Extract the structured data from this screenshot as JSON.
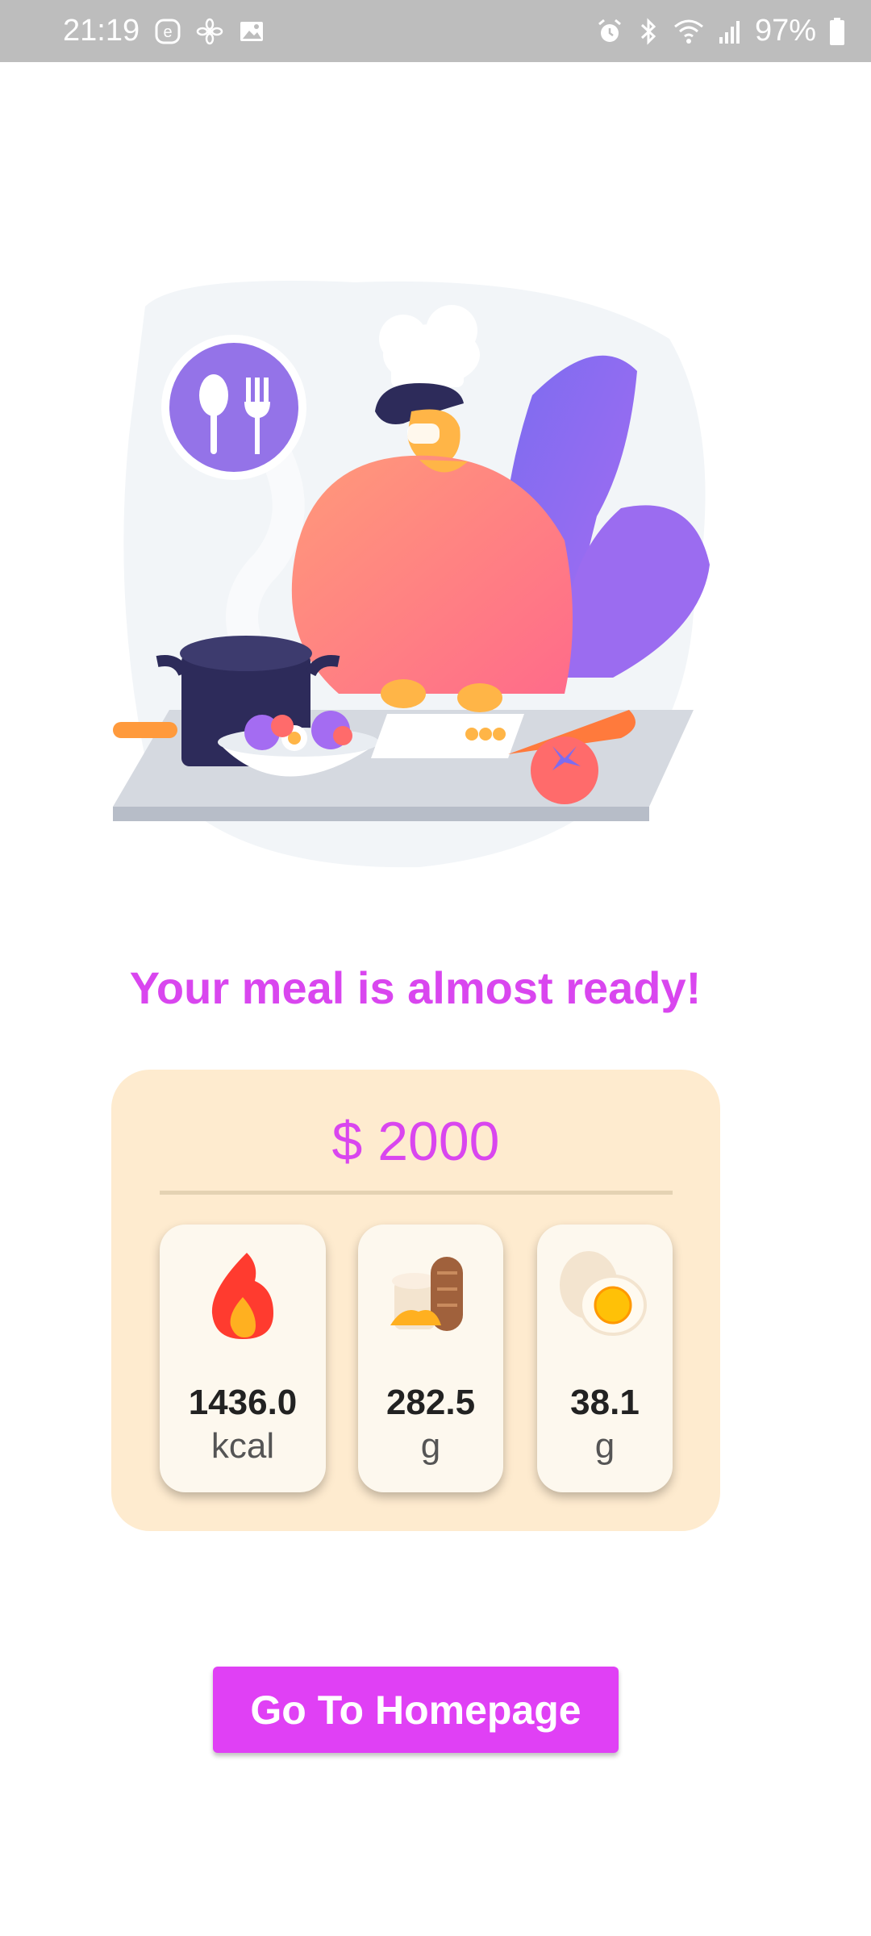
{
  "status_bar": {
    "time": "21:19",
    "battery": "97%",
    "left_icons": [
      "e-badge-icon",
      "pinwheel-icon",
      "image-icon"
    ],
    "right_icons": [
      "alarm-icon",
      "bluetooth-icon",
      "wifi-icon",
      "signal-icon",
      "battery-icon"
    ]
  },
  "illustration": {
    "name": "chef-cooking-illustration"
  },
  "heading": "Your meal is almost ready!",
  "order": {
    "price": "$ 2000",
    "nutrition": [
      {
        "icon": "flame-icon",
        "value": "1436.0",
        "unit": "kcal"
      },
      {
        "icon": "bread-icon",
        "value": "282.5",
        "unit": "g"
      },
      {
        "icon": "egg-icon",
        "value": "38.1",
        "unit": "g"
      }
    ]
  },
  "cta": {
    "label": "Go To Homepage"
  },
  "colors": {
    "accent": "#d946ef",
    "button": "#e040f5",
    "card_bg": "#feebcf"
  }
}
